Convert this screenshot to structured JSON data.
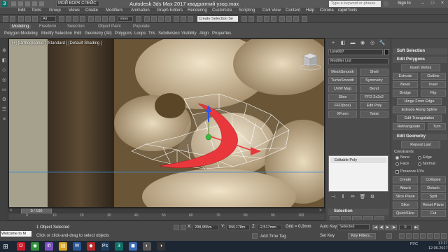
{
  "titlebar": {
    "logo": "3",
    "workspace": "МОЙ ВОРК СПЕЙС",
    "app_title": "Autodesk 3ds Max 2017      квадратний узор.max",
    "search_placeholder": "Type a keyword or phrase",
    "sign_in": "Sign In",
    "minimize": "–",
    "maximize": "□",
    "close": "×"
  },
  "menubar": {
    "items": [
      "Edit",
      "Tools",
      "Group",
      "Views",
      "Create",
      "Modifiers",
      "Animation",
      "Graph Editors",
      "Rendering",
      "Customize",
      "Scripting",
      "Civil View",
      "Content",
      "Help",
      "Corona",
      "rapidTools"
    ]
  },
  "toolbar": {
    "undo_dropdown": "All",
    "view_dropdown": "View",
    "selection_set": "Create Selection Se"
  },
  "ribbon": {
    "tabs": [
      "Modeling",
      "Freeform",
      "Selection",
      "Object Paint",
      "Populate"
    ],
    "active_tab": "Modeling",
    "commands": [
      "Polygon Modeling",
      "Modify Selection",
      "Edit",
      "Geometry (All)",
      "Polygons",
      "Loops",
      "Tris",
      "Subdivision",
      "Visibility",
      "Align",
      "Properties"
    ]
  },
  "viewport": {
    "label": "[+] [Orthographic ] [Standard ] [Default Shading ]",
    "accent_color": "#e8383b"
  },
  "timeslider": {
    "frame_display": "0 / 100",
    "prev": "<",
    "next": ">"
  },
  "trackbar": {
    "ticks": [
      "0",
      "10",
      "20",
      "30",
      "40",
      "50",
      "60",
      "70",
      "80",
      "90",
      "100"
    ]
  },
  "command_panel": {
    "tab_icons": [
      "+",
      "◧",
      "▬",
      "◉",
      "◎",
      "🔧"
    ],
    "object_name": "Line007",
    "modifier_list": "Modifier List",
    "modifier_buttons": [
      "MeshSmooth",
      "Shell",
      "TurboSmooth",
      "Symmetry",
      "UVW Map",
      "Bend",
      "Slice",
      "FFD 2x2x2",
      "FFD(box)",
      "Edit Poly",
      "XForm",
      "Twist"
    ],
    "stack_items": [
      "Editable Poly"
    ],
    "stack_icons": [
      "⊣",
      "‖",
      "✏",
      "🗑",
      "⚙"
    ],
    "selection_rollout": "Selection"
  },
  "panel3": {
    "soft_selection": "Soft Selection",
    "edit_polygons": "Edit Polygons",
    "insert_vertex": "Insert Vertex",
    "extrude": "Extrude",
    "outline": "Outline",
    "bevel": "Bevel",
    "inset": "Inset",
    "bridge": "Bridge",
    "flip": "Flip",
    "hinge_from_edge": "Hinge From Edge",
    "extrude_along_spline": "Extrude Along Spline",
    "edit_triangulation": "Edit Triangulation",
    "retriangulate": "Retriangulate",
    "turn": "Turn",
    "edit_geometry": "Edit Geometry",
    "repeat_last": "Repeat Last",
    "constraints": "Constraints",
    "none": "None",
    "edge": "Edge",
    "face": "Face",
    "normal": "Normal",
    "preserve_uvs": "Preserve UVs",
    "create": "Create",
    "collapse": "Collapse",
    "attach": "Attach",
    "detach": "Detach",
    "slice_plane": "Slice Plane",
    "split": "Split",
    "slice": "Slice",
    "reset_plane": "Reset Plane",
    "quickslice": "QuickSlice",
    "cut": "Cut",
    "msmooth": "MSmooth",
    "tessellate": "Tessellate",
    "make_planar": "Make Planar",
    "xyz": "X  Y  Z"
  },
  "statusbar": {
    "listener": "Welcome to M",
    "selected": "1 Object Selected",
    "prompt": "Click or click-and-drag to select objects",
    "x_label": "X:",
    "x_value": "298,955m",
    "y_label": "Y:",
    "y_value": "158,178m",
    "z_label": "Z:",
    "z_value": "-2,517mm",
    "grid": "Grid = 0,0mm",
    "add_time_tag": "Add Time Tag",
    "auto_key": "Auto Key",
    "set_key": "Set Key",
    "selected_dropdown": "Selected",
    "key_filters": "Key Filters...",
    "frame": "0",
    "play_icons": [
      "|◀",
      "◀|",
      "▶",
      "|▶",
      "▶|"
    ]
  },
  "taskbar": {
    "start": "⊞",
    "apps": [
      {
        "name": "opera",
        "glyph": "O",
        "color": "#cc1b2b"
      },
      {
        "name": "chrome",
        "glyph": "◉",
        "color": "#2f8f3a"
      },
      {
        "name": "viber",
        "glyph": "✆",
        "color": "#7a4fbf"
      },
      {
        "name": "explorer",
        "glyph": "▤",
        "color": "#d9a424"
      },
      {
        "name": "word",
        "glyph": "W",
        "color": "#2b5797"
      },
      {
        "name": "app-red",
        "glyph": "◆",
        "color": "#b52a2a"
      },
      {
        "name": "photoshop",
        "glyph": "Ps",
        "color": "#1d3e5f"
      },
      {
        "name": "3dsmax",
        "glyph": "3",
        "color": "#0e6f66"
      },
      {
        "name": "app-blue",
        "glyph": "◼",
        "color": "#3c6bb5"
      },
      {
        "name": "app-gray",
        "glyph": "◐",
        "color": "#555"
      },
      {
        "name": "app-dark",
        "glyph": "◑",
        "color": "#333"
      }
    ],
    "language": "РУС",
    "time": "17:27",
    "date": "12.06.2017"
  }
}
